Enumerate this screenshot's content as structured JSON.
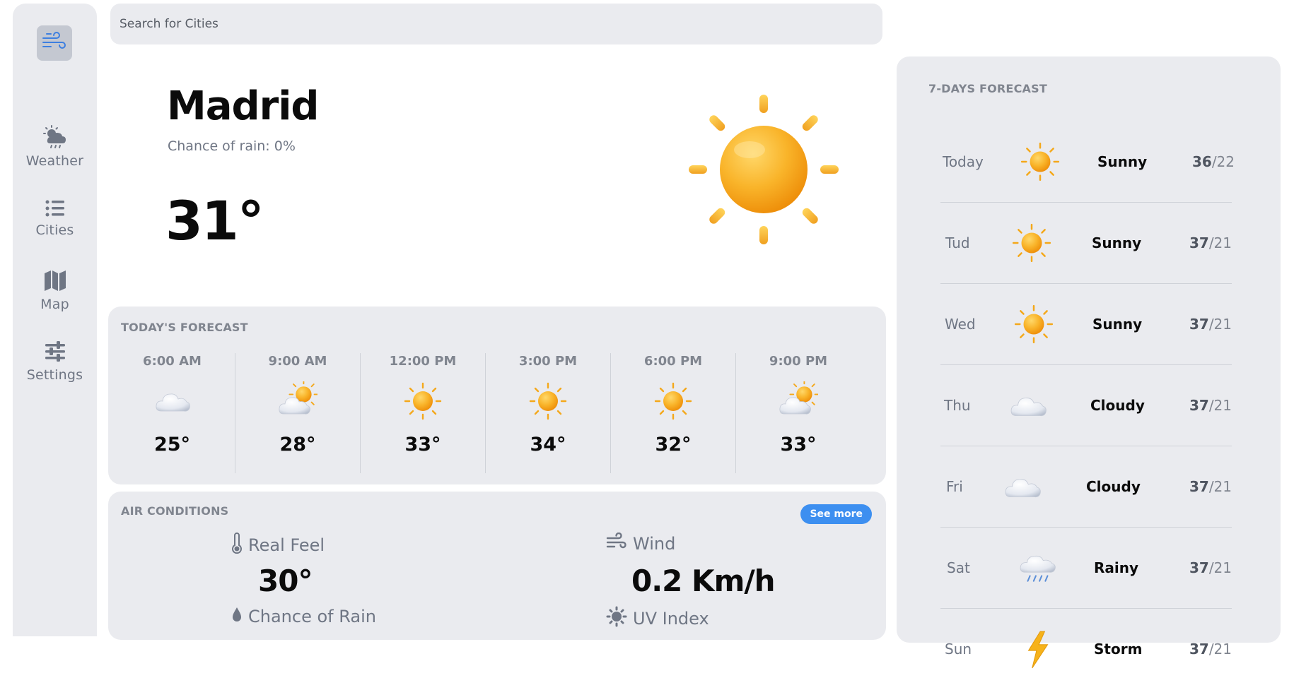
{
  "sidebar": {
    "logo_icon": "wind-icon",
    "items": [
      {
        "label": "Weather",
        "icon": "cloud-sun-rain-icon"
      },
      {
        "label": "Cities",
        "icon": "list-icon"
      },
      {
        "label": "Map",
        "icon": "map-icon"
      },
      {
        "label": "Settings",
        "icon": "sliders-icon"
      }
    ]
  },
  "search": {
    "placeholder": "Search for Cities"
  },
  "current": {
    "city": "Madrid",
    "chance_of_rain": "Chance of rain: 0%",
    "temperature": "31°",
    "icon": "sun-icon"
  },
  "today_forecast": {
    "title": "TODAY'S FORECAST",
    "hours": [
      {
        "time": "6:00 AM",
        "temp": "25°",
        "icon": "cloud-icon"
      },
      {
        "time": "9:00 AM",
        "temp": "28°",
        "icon": "sun-behind-cloud-icon"
      },
      {
        "time": "12:00 PM",
        "temp": "33°",
        "icon": "sun-icon"
      },
      {
        "time": "3:00 PM",
        "temp": "34°",
        "icon": "sun-icon"
      },
      {
        "time": "6:00 PM",
        "temp": "32°",
        "icon": "sun-icon"
      },
      {
        "time": "9:00 PM",
        "temp": "33°",
        "icon": "sun-behind-cloud-icon"
      }
    ]
  },
  "air_conditions": {
    "title": "AIR CONDITIONS",
    "see_more": "See more",
    "real_feel": {
      "label": "Real Feel",
      "value": "30°",
      "icon": "thermometer-icon"
    },
    "wind": {
      "label": "Wind",
      "value": "0.2 Km/h",
      "icon": "wind-icon"
    },
    "chance_of_rain": {
      "label": "Chance of Rain",
      "icon": "droplet-icon"
    },
    "uv_index": {
      "label": "UV Index",
      "icon": "sun-outline-icon"
    }
  },
  "week_forecast": {
    "title": "7-DAYS FORECAST",
    "days": [
      {
        "day": "Today",
        "condition": "Sunny",
        "high": "36",
        "low": "/22",
        "icon": "sun-icon"
      },
      {
        "day": "Tud",
        "condition": "Sunny",
        "high": "37",
        "low": "/21",
        "icon": "sun-icon"
      },
      {
        "day": "Wed",
        "condition": "Sunny",
        "high": "37",
        "low": "/21",
        "icon": "sun-icon"
      },
      {
        "day": "Thu",
        "condition": "Cloudy",
        "high": "37",
        "low": "/21",
        "icon": "cloud-icon"
      },
      {
        "day": "Fri",
        "condition": "Cloudy",
        "high": "37",
        "low": "/21",
        "icon": "cloud-icon"
      },
      {
        "day": "Sat",
        "condition": "Rainy",
        "high": "37",
        "low": "/21",
        "icon": "rain-cloud-icon"
      },
      {
        "day": "Sun",
        "condition": "Storm",
        "high": "37",
        "low": "/21",
        "icon": "lightning-icon"
      }
    ]
  },
  "colors": {
    "panel": "#eaebef",
    "accent": "#3d8ff0",
    "muted": "#80858f",
    "sun": "#f6a514"
  }
}
